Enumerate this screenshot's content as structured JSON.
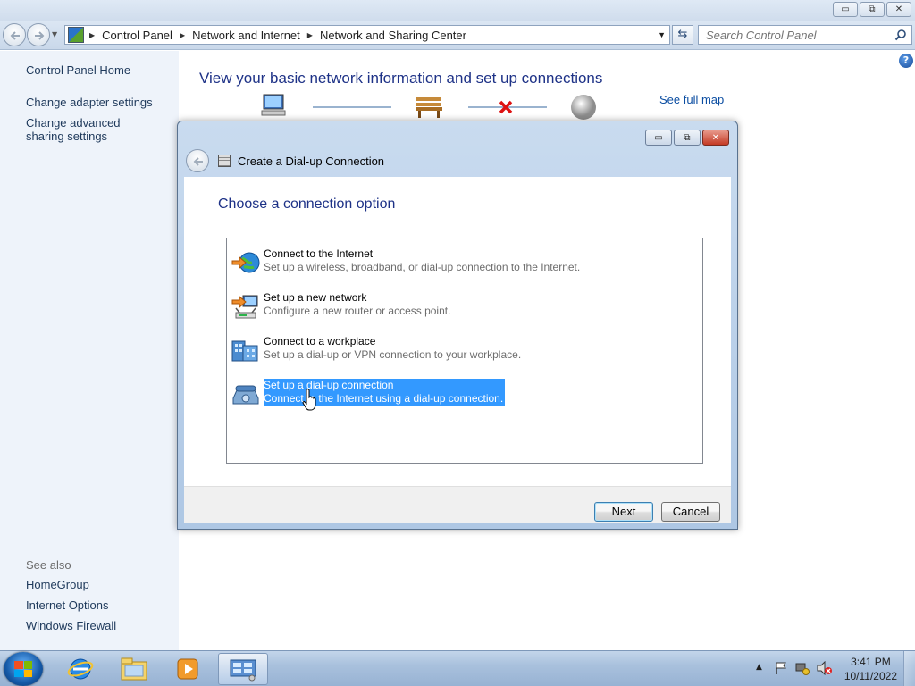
{
  "window": {
    "caption_buttons": {
      "minimize": "▭",
      "restore": "⧉",
      "close": "✕"
    }
  },
  "address_bar": {
    "breadcrumbs": [
      "Control Panel",
      "Network and Internet",
      "Network and Sharing Center"
    ],
    "search_placeholder": "Search Control Panel"
  },
  "left_pane": {
    "links": [
      "Control Panel Home",
      "Change adapter settings",
      "Change advanced sharing settings"
    ],
    "see_also_label": "See also",
    "see_also_links": [
      "HomeGroup",
      "Internet Options",
      "Windows Firewall"
    ]
  },
  "main": {
    "title": "View your basic network information and set up connections",
    "see_full_map": "See full map",
    "help_icon": "?"
  },
  "dialog": {
    "title": "Create a Dial-up Connection",
    "heading": "Choose a connection option",
    "options": [
      {
        "title": "Connect to the Internet",
        "description": "Set up a wireless, broadband, or dial-up connection to the Internet.",
        "icon": "globe-icon",
        "selected": false
      },
      {
        "title": "Set up a new network",
        "description": "Configure a new router or access point.",
        "icon": "network-icon",
        "selected": false
      },
      {
        "title": "Connect to a workplace",
        "description": "Set up a dial-up or VPN connection to your workplace.",
        "icon": "workplace-icon",
        "selected": false
      },
      {
        "title": "Set up a dial-up connection",
        "description": "Connect to the Internet using a dial-up connection.",
        "icon": "phone-icon",
        "selected": true
      }
    ],
    "next_label": "Next",
    "cancel_label": "Cancel"
  },
  "taskbar": {
    "time": "3:41 PM",
    "date": "10/11/2022",
    "pinned": [
      "internet-explorer-icon",
      "file-explorer-icon",
      "media-player-icon",
      "control-panel-icon"
    ]
  },
  "colors": {
    "link": "#1e395b",
    "title": "#1e3287",
    "selection": "#3399ff",
    "left_pane_bg": "#eef3fa"
  }
}
